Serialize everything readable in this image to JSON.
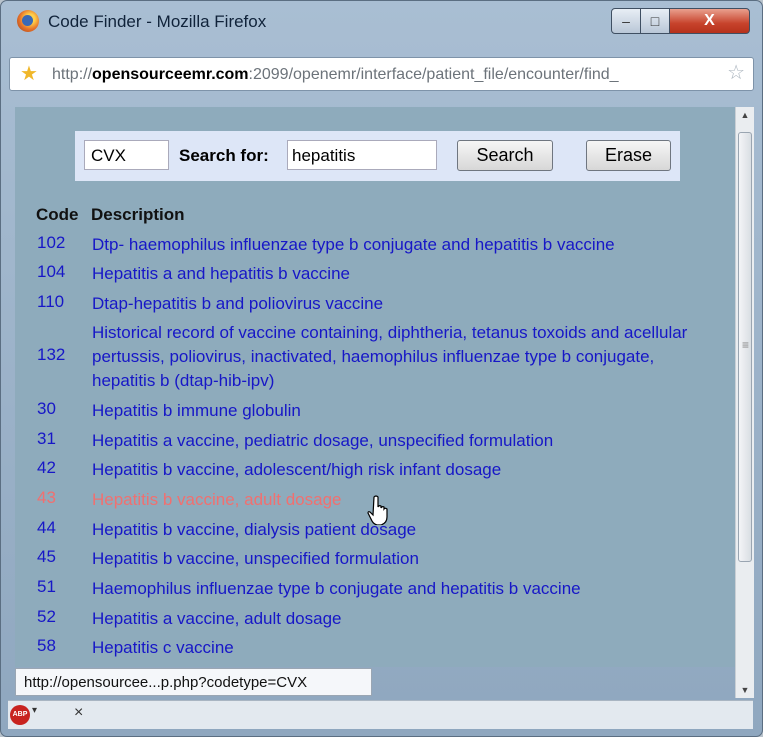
{
  "window": {
    "title": "Code Finder - Mozilla Firefox",
    "url_prefix": "http://",
    "url_domain": "opensourceemr.com",
    "url_rest": ":2099/openemr/interface/patient_file/encounter/find_",
    "min_glyph": "–",
    "max_glyph": "□",
    "close_glyph": "X",
    "bookmark_star": "★",
    "favorite_star": "☆"
  },
  "search": {
    "code_type": "CVX",
    "label": "Search for:",
    "query": "hepatitis",
    "search_button": "Search",
    "erase_button": "Erase"
  },
  "table": {
    "header_code": "Code",
    "header_description": "Description",
    "rows": [
      {
        "code": "102",
        "description": "Dtp- haemophilus influenzae type b conjugate and hepatitis b vaccine"
      },
      {
        "code": "104",
        "description": "Hepatitis a and hepatitis b vaccine"
      },
      {
        "code": "110",
        "description": "Dtap-hepatitis b and poliovirus vaccine"
      },
      {
        "code": "132",
        "description": "Historical record of vaccine containing, diphtheria, tetanus toxoids and acellular pertussis, poliovirus, inactivated, haemophilus influenzae type b conjugate, hepatitis b (dtap-hib-ipv)"
      },
      {
        "code": "30",
        "description": "Hepatitis b immune globulin"
      },
      {
        "code": "31",
        "description": "Hepatitis a vaccine, pediatric dosage, unspecified formulation"
      },
      {
        "code": "42",
        "description": "Hepatitis b vaccine, adolescent/high risk infant dosage"
      },
      {
        "code": "43",
        "description": "Hepatitis b vaccine, adult dosage"
      },
      {
        "code": "44",
        "description": "Hepatitis b vaccine, dialysis patient dosage"
      },
      {
        "code": "45",
        "description": "Hepatitis b vaccine, unspecified formulation"
      },
      {
        "code": "51",
        "description": "Haemophilus influenzae type b conjugate and hepatitis b vaccine"
      },
      {
        "code": "52",
        "description": "Hepatitis a vaccine, adult dosage"
      },
      {
        "code": "58",
        "description": "Hepatitis c vaccine"
      }
    ]
  },
  "status_bar": {
    "link_preview": "http://opensourcee...p.php?codetype=CVX",
    "addon_label": "ABP",
    "close_glyph": "×"
  },
  "colors": {
    "link": "#1717c7",
    "hover_link": "#f07070",
    "content_bg": "#8eabbc",
    "search_panel_bg": "#dde6f7"
  }
}
